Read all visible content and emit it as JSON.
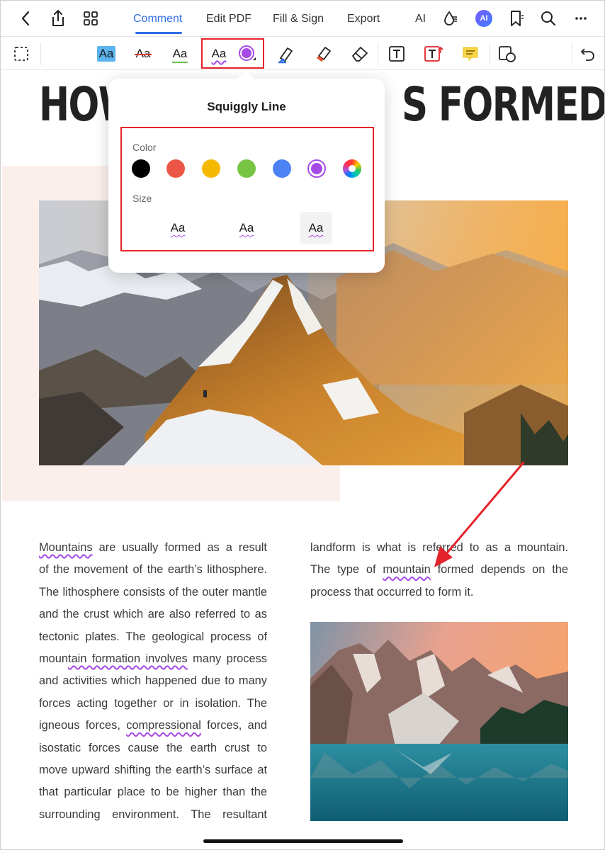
{
  "nav": {
    "tabs": [
      {
        "label": "Comment",
        "active": true
      },
      {
        "label": "Edit PDF"
      },
      {
        "label": "Fill & Sign"
      },
      {
        "label": "Export"
      },
      {
        "label": "AI"
      }
    ],
    "ai_badge": "AI",
    "icons": [
      "back-icon",
      "share-icon",
      "grid-icon",
      "ink-drop-icon",
      "ai-badge-icon",
      "bookmark-icon",
      "search-icon",
      "more-icon"
    ]
  },
  "toolbar": {
    "tools": [
      {
        "name": "lasso-select",
        "icon": "dashed-select-icon"
      },
      {
        "name": "highlight",
        "label": "Aa"
      },
      {
        "name": "strikethrough",
        "label": "Aa"
      },
      {
        "name": "underline",
        "label": "Aa"
      },
      {
        "name": "squiggly",
        "label": "Aa",
        "selected": true
      },
      {
        "name": "color",
        "icon": "color-circle-icon"
      },
      {
        "name": "pen",
        "icon": "pen-icon"
      },
      {
        "name": "highlighter",
        "icon": "highlighter-icon"
      },
      {
        "name": "eraser",
        "icon": "eraser-icon"
      },
      {
        "name": "textbox",
        "icon": "textbox-icon"
      },
      {
        "name": "typewriter",
        "icon": "typewriter-icon"
      },
      {
        "name": "note",
        "icon": "note-icon"
      },
      {
        "name": "shapes",
        "icon": "shapes-icon"
      },
      {
        "name": "undo",
        "icon": "undo-icon"
      }
    ],
    "accent": "#2f6fe6"
  },
  "popover": {
    "title": "Squiggly Line",
    "color_label": "Color",
    "size_label": "Size",
    "colors": [
      "#000000",
      "#eb5545",
      "#f5b800",
      "#78c544",
      "#4d82f4",
      "#a64ae6",
      "wheel"
    ],
    "selected_color": "#a64ae6",
    "sizes": [
      "Aa",
      "Aa",
      "Aa"
    ],
    "selected_size": 2
  },
  "document": {
    "heading_left": "HOW",
    "heading_right": "S FORMED?",
    "left_column": [
      [
        "Mountains",
        " are usually formed as a result"
      ],
      [
        "of the movement of the earth’s lithosphere."
      ],
      [
        "The lithosphere consists of the outer mantle"
      ],
      [
        "and the crust which are also referred to as"
      ],
      [
        "tectonic plates. The geological process of"
      ],
      [
        "moun",
        "tain formation involves",
        " many process"
      ],
      [
        "and activities which happened due to many"
      ],
      [
        "forces acting together or in isolation. The"
      ],
      [
        "igneous forces, ",
        "compressional",
        " forces, and"
      ],
      [
        "isostatic forces cause the earth crust to"
      ],
      [
        "move upward shifting the earth’s surface at"
      ],
      [
        "that particular place to be higher than the"
      ],
      [
        "surrounding environment. The resultant"
      ]
    ],
    "right_column": {
      "line1": "landform is what is referred to as a mountain.",
      "line2_pre": "The type of ",
      "line2_sq": "mountain",
      "line2_post": " formed depends on the",
      "line3": "process that occurred to form it."
    }
  }
}
